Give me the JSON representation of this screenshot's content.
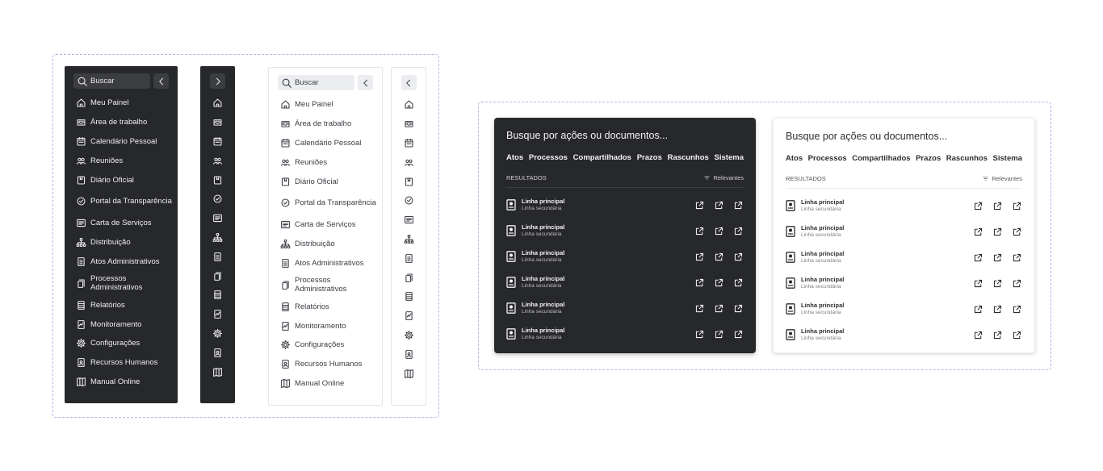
{
  "sidebar": {
    "search_placeholder": "Buscar",
    "items": [
      {
        "label": "Meu Painel",
        "icon": "home-icon"
      },
      {
        "label": "Área de trabalho",
        "icon": "inbox-icon"
      },
      {
        "label": "Calendário Pessoal",
        "icon": "calendar-icon"
      },
      {
        "label": "Reuniões",
        "icon": "users-icon"
      },
      {
        "label": "Diário Oficial",
        "icon": "bookmark-book-icon"
      },
      {
        "label": "Portal da Transparência",
        "icon": "check-circle-icon"
      },
      {
        "label": "Carta de Serviços",
        "icon": "list-card-icon"
      },
      {
        "label": "Distribuição",
        "icon": "org-chart-icon"
      },
      {
        "label": "Atos Administrativos",
        "icon": "document-icon"
      },
      {
        "label": "Processos Administrativos",
        "icon": "copy-icon"
      },
      {
        "label": "Relatórios",
        "icon": "report-icon"
      },
      {
        "label": "Monitoramento",
        "icon": "monitor-icon"
      },
      {
        "label": "Configurações",
        "icon": "gear-icon"
      },
      {
        "label": "Recursos Humanos",
        "icon": "badge-icon"
      },
      {
        "label": "Manual Online",
        "icon": "map-book-icon"
      }
    ]
  },
  "search_panel": {
    "title": "Busque por ações ou documentos...",
    "tabs": [
      "Atos",
      "Processos",
      "Compartilhados",
      "Prazos",
      "Rascunhos",
      "Sistema"
    ],
    "results_label": "RESULTADOS",
    "sort_label": "Relevantes",
    "results": [
      {
        "primary": "Linha principal",
        "secondary": "Linha secundária"
      },
      {
        "primary": "Linha principal",
        "secondary": "Linha secundária"
      },
      {
        "primary": "Linha principal",
        "secondary": "Linha secundária"
      },
      {
        "primary": "Linha principal",
        "secondary": "Linha secundária"
      },
      {
        "primary": "Linha principal",
        "secondary": "Linha secundária"
      },
      {
        "primary": "Linha principal",
        "secondary": "Linha secundária"
      }
    ]
  },
  "colors": {
    "dark_bg": "#27282b",
    "dashed_border": "#b9b1ee",
    "light_bg": "#ffffff"
  }
}
